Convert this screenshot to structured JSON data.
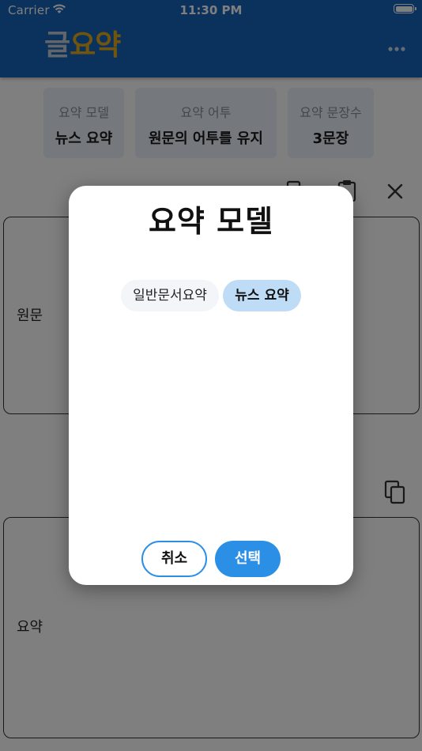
{
  "status_bar": {
    "carrier": "Carrier",
    "time": "11:30 PM"
  },
  "header": {
    "title_part1": "글",
    "title_part2": "요약",
    "menu_icon": "more-horizontal-icon"
  },
  "settings": [
    {
      "label": "요약 모델",
      "value": "뉴스 요약"
    },
    {
      "label": "요약 어투",
      "value": "원문의 어투를 유지"
    },
    {
      "label": "요약 문장수",
      "value": "3문장"
    }
  ],
  "source_box": {
    "label": "원문",
    "icons": [
      "copy-icon",
      "paste-icon",
      "clear-icon"
    ]
  },
  "summary_box": {
    "label": "요약",
    "icons": [
      "copy-icon"
    ]
  },
  "dialog": {
    "title": "요약 모델",
    "options": [
      {
        "label": "일반문서요약",
        "selected": false
      },
      {
        "label": "뉴스 요약",
        "selected": true
      }
    ],
    "cancel_label": "취소",
    "confirm_label": "선택"
  },
  "colors": {
    "header_bg": "#1565b8",
    "accent": "#2c8fe6",
    "selected_option_bg": "#bfdcf6",
    "title_gold": "#e2a81b"
  }
}
